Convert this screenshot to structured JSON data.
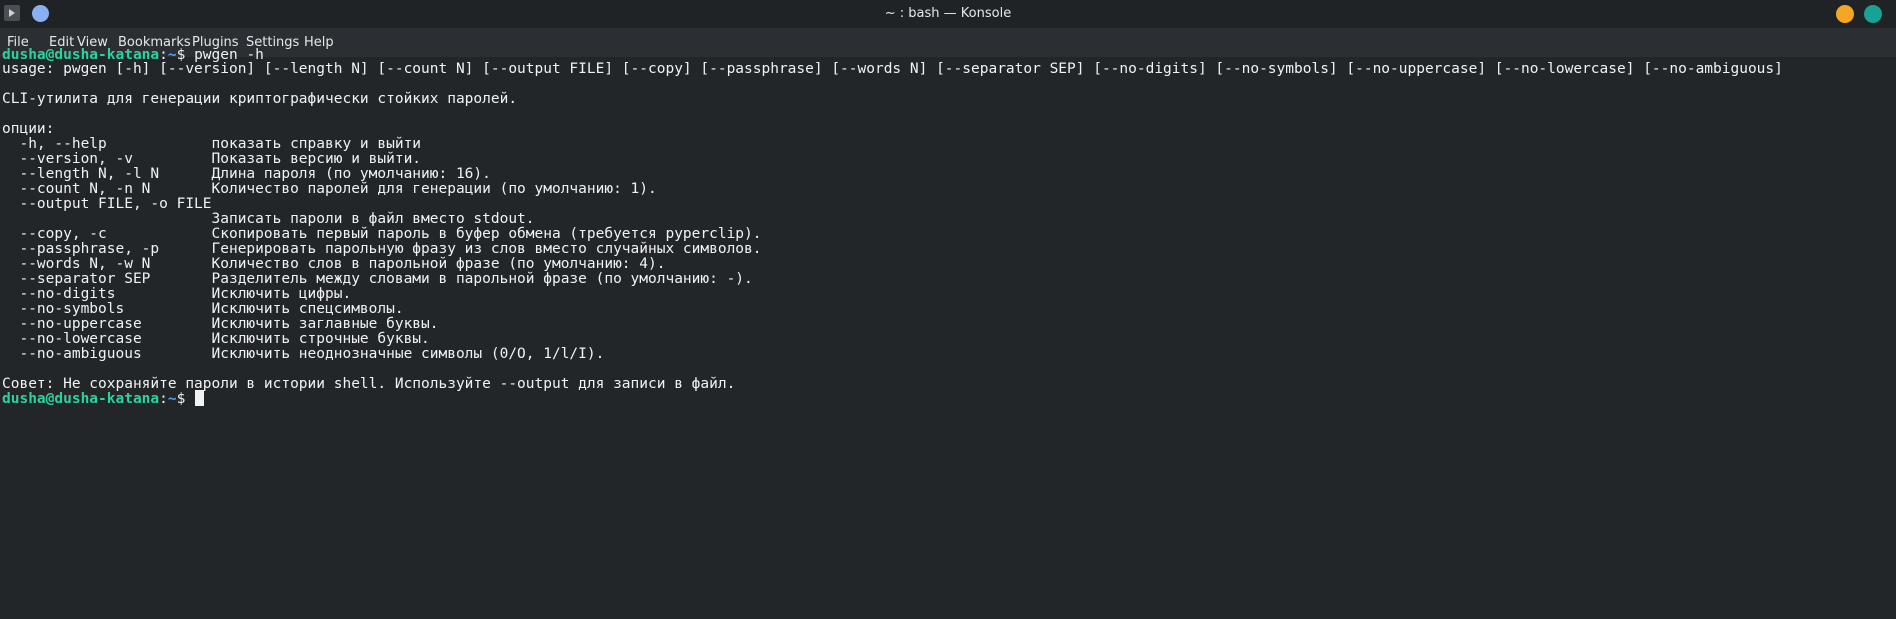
{
  "window": {
    "title": "~ : bash — Konsole",
    "icons": {
      "app": "terminal-icon",
      "pin": "pin-icon",
      "minimize": "minimize-icon",
      "close": "close-icon"
    },
    "colors": {
      "pin": "#8ab0f2",
      "minimize": "#f5a623",
      "close": "#18a195"
    }
  },
  "menu": {
    "file": "File",
    "edit": "Edit",
    "view": "View",
    "bookmarks": "Bookmarks",
    "plugins": "Plugins",
    "settings": "Settings",
    "help": "Help"
  },
  "terminal": {
    "colors": {
      "background": "#232629",
      "text": "#f0f2f4",
      "user_host": "#2bd39a",
      "path": "#4aa3ff"
    },
    "prompt": {
      "user_host": "dusha@dusha-katana",
      "separator": ":",
      "path": "~",
      "symbol": "$"
    },
    "command": " pwgen -h",
    "output": [
      "usage: pwgen [-h] [--version] [--length N] [--count N] [--output FILE] [--copy] [--passphrase] [--words N] [--separator SEP] [--no-digits] [--no-symbols] [--no-uppercase] [--no-lowercase] [--no-ambiguous]",
      "",
      "CLI-утилита для генерации криптографически стойких паролей.",
      "",
      "опции:",
      "  -h, --help            показать справку и выйти",
      "  --version, -v         Показать версию и выйти.",
      "  --length N, -l N      Длина пароля (по умолчанию: 16).",
      "  --count N, -n N       Количество паролей для генерации (по умолчанию: 1).",
      "  --output FILE, -o FILE",
      "                        Записать пароли в файл вместо stdout.",
      "  --copy, -c            Скопировать первый пароль в буфер обмена (требуется pyperclip).",
      "  --passphrase, -p      Генерировать парольную фразу из слов вместо случайных символов.",
      "  --words N, -w N       Количество слов в парольной фразе (по умолчанию: 4).",
      "  --separator SEP       Разделитель между словами в парольной фразе (по умолчанию: -).",
      "  --no-digits           Исключить цифры.",
      "  --no-symbols          Исключить спецсимволы.",
      "  --no-uppercase        Исключить заглавные буквы.",
      "  --no-lowercase        Исключить строчные буквы.",
      "  --no-ambiguous        Исключить неоднозначные символы (0/O, 1/l/I).",
      "",
      "Совет: Не сохраняйте пароли в истории shell. Используйте --output для записи в файл."
    ]
  }
}
